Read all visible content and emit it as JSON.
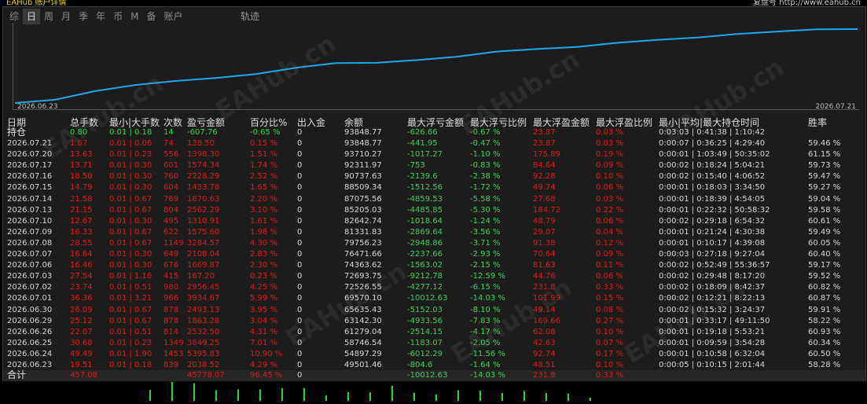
{
  "title_left": "EAHub 账户详情",
  "title_right": "复盘号 http://www.eahub.cn",
  "tabs": [
    "综",
    "日",
    "周",
    "月",
    "季",
    "年",
    "币",
    "M",
    "备",
    "账户"
  ],
  "active_tab": "日",
  "track_label": "轨迹",
  "chart": {
    "start_date": "2026.06.23",
    "end_date": "2026.07.21",
    "line_color": "#1ea8e8",
    "watermark": "EAHub.cn"
  },
  "headers": {
    "date": "日期",
    "total_lots": "总手数",
    "min_max_lots": "最小|大手数",
    "count": "次数",
    "pnl": "盈亏金额",
    "pct": "百分比%",
    "inout": "出入金",
    "balance": "余额",
    "max_float_loss": "最大浮亏金额",
    "max_float_loss_pct": "最大浮亏比例",
    "max_float_profit": "最大浮盈金额",
    "max_float_profit_pct": "最大浮盈比例",
    "hold_time": "最小|平均|最大持仓时间",
    "winrate": "胜率"
  },
  "position_row": {
    "label": "持仓",
    "lots": "0.80",
    "minmax": "0.01 | 0.18",
    "count": "14",
    "pnl": "-607.76",
    "pct": "-0.65 %",
    "inout": "0",
    "balance": "93848.77",
    "fl": "-626.66",
    "flp": "-0.67 %",
    "fp": "23.87",
    "fpp": "0.03 %",
    "hold": "0:03:03 | 0:41:38 | 1:10:42",
    "win": ""
  },
  "rows": [
    {
      "date": "2026.07.21",
      "lots": "1.67",
      "minmax": "0.01 | 0.06",
      "count": "74",
      "pnl": "138.50",
      "pct": "0.15 %",
      "inout": "0",
      "balance": "93848.77",
      "fl": "-441.95",
      "flp": "-0.47 %",
      "fp": "23.87",
      "fpp": "0.03 %",
      "hold": "0:00:07 | 0:36:25 | 4:29:40",
      "win": "59.46 %"
    },
    {
      "date": "2026.07.20",
      "lots": "13.63",
      "minmax": "0.01 | 0.23",
      "count": "556",
      "pnl": "1398.30",
      "pct": "1.51 %",
      "inout": "0",
      "balance": "93710.27",
      "fl": "-1017.27",
      "flp": "-1.10 %",
      "fp": "175.89",
      "fpp": "0.19 %",
      "hold": "0:00:01 | 1:03:49 | 50:35:02",
      "win": "61.15 %"
    },
    {
      "date": "2026.07.17",
      "lots": "13.71",
      "minmax": "0.01 | 0.30",
      "count": "601",
      "pnl": "1574.34",
      "pct": "1.74 %",
      "inout": "0",
      "balance": "92311.97",
      "fl": "-753",
      "flp": "-0.83 %",
      "fp": "84.64",
      "fpp": "0.09 %",
      "hold": "0:00:02 | 0:18:24 | 5:04:21",
      "win": "59.73 %"
    },
    {
      "date": "2026.07.16",
      "lots": "18.50",
      "minmax": "0.01 | 0.30",
      "count": "760",
      "pnl": "2228.29",
      "pct": "2.52 %",
      "inout": "0",
      "balance": "90737.63",
      "fl": "-2139.6",
      "flp": "-2.38 %",
      "fp": "92.28",
      "fpp": "0.10 %",
      "hold": "0:00:02 | 0:15:40 | 4:06:52",
      "win": "59.47 %"
    },
    {
      "date": "2026.07.15",
      "lots": "14.79",
      "minmax": "0.01 | 0.30",
      "count": "604",
      "pnl": "1433.78",
      "pct": "1.65 %",
      "inout": "0",
      "balance": "88509.34",
      "fl": "-1512.56",
      "flp": "-1.72 %",
      "fp": "49.74",
      "fpp": "0.06 %",
      "hold": "0:00:01 | 0:18:03 | 3:34:50",
      "win": "59.27 %"
    },
    {
      "date": "2026.07.14",
      "lots": "21.58",
      "minmax": "0.01 | 0.67",
      "count": "769",
      "pnl": "1870.63",
      "pct": "2.20 %",
      "inout": "0",
      "balance": "87075.56",
      "fl": "-4859.53",
      "flp": "-5.58 %",
      "fp": "27.68",
      "fpp": "0.03 %",
      "hold": "0:00:01 | 0:18:39 | 4:54:05",
      "win": "59.04 %"
    },
    {
      "date": "2026.07.13",
      "lots": "21.15",
      "minmax": "0.01 | 0.67",
      "count": "804",
      "pnl": "2562.29",
      "pct": "3.10 %",
      "inout": "0",
      "balance": "85205.03",
      "fl": "-4485.85",
      "flp": "-5.30 %",
      "fp": "184.72",
      "fpp": "0.22 %",
      "hold": "0:00:01 | 0:22:32 | 50:58:32",
      "win": "59.58 %"
    },
    {
      "date": "2026.07.10",
      "lots": "12.67",
      "minmax": "0.01 | 0.30",
      "count": "495",
      "pnl": "1310.91",
      "pct": "1.61 %",
      "inout": "0",
      "balance": "82642.74",
      "fl": "-1018.64",
      "flp": "-1.24 %",
      "fp": "48.79",
      "fpp": "0.06 %",
      "hold": "0:00:02 | 0:29:18 | 6:54:32",
      "win": "60.61 %"
    },
    {
      "date": "2026.07.09",
      "lots": "16.33",
      "minmax": "0.01 | 0.67",
      "count": "622",
      "pnl": "1575.60",
      "pct": "1.98 %",
      "inout": "0",
      "balance": "81331.83",
      "fl": "-2869.64",
      "flp": "-3.56 %",
      "fp": "29.07",
      "fpp": "0.04 %",
      "hold": "0:00:01 | 0:21:24 | 4:30:38",
      "win": "59.49 %"
    },
    {
      "date": "2026.07.08",
      "lots": "28.55",
      "minmax": "0.01 | 0.67",
      "count": "1149",
      "pnl": "3284.57",
      "pct": "4.30 %",
      "inout": "0",
      "balance": "79756.23",
      "fl": "-2948.86",
      "flp": "-3.71 %",
      "fp": "91.38",
      "fpp": "0.12 %",
      "hold": "0:00:01 | 0:10:17 | 4:39:08",
      "win": "60.05 %"
    },
    {
      "date": "2026.07.07",
      "lots": "16.64",
      "minmax": "0.01 | 0.30",
      "count": "649",
      "pnl": "2108.04",
      "pct": "2.83 %",
      "inout": "0",
      "balance": "76471.66",
      "fl": "-2237.66",
      "flp": "-2.93 %",
      "fp": "70.64",
      "fpp": "0.09 %",
      "hold": "0:00:03 | 0:27:18 | 9:27:04",
      "win": "60.40 %"
    },
    {
      "date": "2026.07.06",
      "lots": "16.46",
      "minmax": "0.01 | 0.30",
      "count": "676",
      "pnl": "1669.87",
      "pct": "2.30 %",
      "inout": "0",
      "balance": "74363.62",
      "fl": "-1563.02",
      "flp": "-2.15 %",
      "fp": "81.63",
      "fpp": "0.11 %",
      "hold": "0:00:02 | 0:52:49 | 55:36:57",
      "win": "59.17 %"
    },
    {
      "date": "2026.07.03",
      "lots": "27.54",
      "minmax": "0.01 | 1.16",
      "count": "415",
      "pnl": "167.20",
      "pct": "0.23 %",
      "inout": "0",
      "balance": "72693.75",
      "fl": "-9212.78",
      "flp": "-12.59 %",
      "fp": "44.76",
      "fpp": "0.06 %",
      "hold": "0:00:02 | 0:29:48 | 8:17:20",
      "win": "59.52 %"
    },
    {
      "date": "2026.07.02",
      "lots": "23.74",
      "minmax": "0.01 | 0.51",
      "count": "980",
      "pnl": "2956.45",
      "pct": "4.25 %",
      "inout": "0",
      "balance": "72526.55",
      "fl": "-4277.12",
      "flp": "-6.15 %",
      "fp": "231.8",
      "fpp": "0.33 %",
      "hold": "0:00:02 | 0:18:09 | 8:42:37",
      "win": "60.82 %"
    },
    {
      "date": "2026.07.01",
      "lots": "36.36",
      "minmax": "0.01 | 3.21",
      "count": "966",
      "pnl": "3934.67",
      "pct": "5.99 %",
      "inout": "0",
      "balance": "69570.10",
      "fl": "-10012.63",
      "flp": "-14.03 %",
      "fp": "101.99",
      "fpp": "0.15 %",
      "hold": "0:00:02 | 0:12:21 | 8:22:13",
      "win": "60.87 %"
    },
    {
      "date": "2026.06.30",
      "lots": "26.09",
      "minmax": "0.01 | 0.67",
      "count": "878",
      "pnl": "2493.13",
      "pct": "3.95 %",
      "inout": "0",
      "balance": "65635.43",
      "fl": "-5152.03",
      "flp": "-8.10 %",
      "fp": "49.14",
      "fpp": "0.08 %",
      "hold": "0:00:02 | 0:15:32 | 3:24:37",
      "win": "59.91 %"
    },
    {
      "date": "2026.06.29",
      "lots": "25.12",
      "minmax": "0.01 | 0.67",
      "count": "878",
      "pnl": "1863.28",
      "pct": "3.04 %",
      "inout": "0",
      "balance": "63142.30",
      "fl": "-4933.56",
      "flp": "-7.83 %",
      "fp": "169.66",
      "fpp": "0.27 %",
      "hold": "0:00:01 | 0:33:17 | 49:11:50",
      "win": "58.22 %"
    },
    {
      "date": "2026.06.26",
      "lots": "22.07",
      "minmax": "0.01 | 0.51",
      "count": "814",
      "pnl": "2532.50",
      "pct": "4.31 %",
      "inout": "0",
      "balance": "61279.04",
      "fl": "-2514.15",
      "flp": "-4.17 %",
      "fp": "62.08",
      "fpp": "0.10 %",
      "hold": "0:00:01 | 0:19:18 | 5:53:21",
      "win": "60.93 %"
    },
    {
      "date": "2026.06.25",
      "lots": "30.68",
      "minmax": "0.01 | 0.23",
      "count": "1349",
      "pnl": "3849.25",
      "pct": "7.01 %",
      "inout": "0",
      "balance": "58746.54",
      "fl": "-1183.07",
      "flp": "-2.05 %",
      "fp": "42.63",
      "fpp": "0.07 %",
      "hold": "0:00:01 | 0:09:59 | 3:54:28",
      "win": "60.34 %"
    },
    {
      "date": "2026.06.24",
      "lots": "49.49",
      "minmax": "0.01 | 1.90",
      "count": "1453",
      "pnl": "5395.83",
      "pct": "10.90 %",
      "inout": "0",
      "balance": "54897.29",
      "fl": "-6012.29",
      "flp": "-11.56 %",
      "fp": "92.74",
      "fpp": "0.17 %",
      "hold": "0:00:01 | 0:10:58 | 6:32:04",
      "win": "60.50 %"
    },
    {
      "date": "2026.06.23",
      "lots": "19.51",
      "minmax": "0.01 | 0.18",
      "count": "839",
      "pnl": "2038.52",
      "pct": "4.29 %",
      "inout": "0",
      "balance": "49501.46",
      "fl": "-804.6",
      "flp": "-1.64 %",
      "fp": "48.51",
      "fpp": "0.10 %",
      "hold": "0:00:05 | 0:10:15 | 2:01:44",
      "win": "58.28 %"
    }
  ],
  "total_row": {
    "label": "合计",
    "lots": "457.08",
    "pnl": "45778.07",
    "pct": "96.45 %",
    "inout": "0",
    "fl": "-10012.63",
    "flp": "-14.03 %",
    "fp": "231.8",
    "fpp": "0.33 %"
  }
}
